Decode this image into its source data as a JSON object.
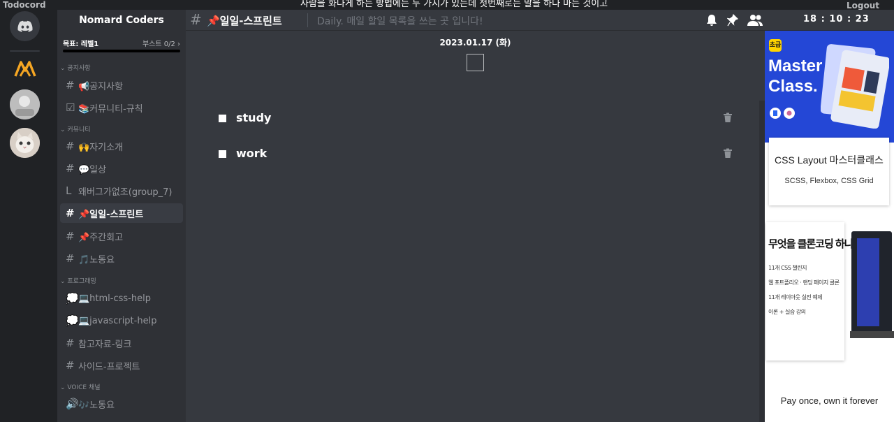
{
  "window": {
    "app_title": "Todocord",
    "quote": "사람을 화나게 하는 방법에는 두 가지가 있는데 첫번째로는 말을 하다 마는 것이고",
    "logout_label": "Logout"
  },
  "servers": [
    {
      "name": "discord-home",
      "icon": "discord-icon"
    },
    {
      "name": "nomad",
      "icon": "nomad-logo"
    },
    {
      "name": "avatar-1",
      "icon": "avatar"
    },
    {
      "name": "avatar-2",
      "icon": "cat-avatar"
    }
  ],
  "sidebar": {
    "server_name": "Nomard Coders",
    "goal_label": "목표: 레벨1",
    "boost_label": "부스트 0/2",
    "categories": {
      "notice": "⌄ 공지사항",
      "community": "⌄ 커뮤니티",
      "programming": "⌄ 프로그래밍",
      "voice": "⌄ VOICE 채널"
    },
    "channels": {
      "notice": "📢공지사항",
      "rules": "📚커뮤니티-규칙",
      "intro": "🙌자기소개",
      "daily": "💬일상",
      "thread": "왜버그가없조(group_7)",
      "sprint": "📌일일-스프린트",
      "weekly": "📌주간회고",
      "music": "🎵노동요",
      "html_css": "💻html-css-help",
      "javascript": "💻javascript-help",
      "reference": "참고자료-링크",
      "side_project": "사이드-프로젝트",
      "voice_music": "🎶노동요"
    }
  },
  "header": {
    "title": "📌일일-스프린트",
    "topic": "Daily. 매일 할일 목록을 쓰는 곳 입니다!",
    "clock": "18 : 10 : 23",
    "icons": [
      "bell-icon",
      "pin-icon",
      "members-icon"
    ]
  },
  "main": {
    "date": "2023.01.17 (화)",
    "todos": [
      {
        "text": "study",
        "done": false
      },
      {
        "text": "work",
        "done": false
      }
    ]
  },
  "ad": {
    "badge": "초급",
    "headline": "Master Class.",
    "card_title": "CSS Layout 마스터클래스",
    "card_sub": "SCSS, Flexbox, CSS Grid",
    "question": "무엇을 클론코딩 하나요?",
    "lines": [
      "11개 CSS 챌린지",
      "웹 포트폴리오 · 랜딩 페이지 클론",
      "11개 레이아웃 실전 예제",
      "이론 + 실습 강의"
    ],
    "footer": "Pay once, own it forever"
  },
  "colors": {
    "background": "#202225",
    "sidebar": "#2f3136",
    "main": "#36393f",
    "active_channel": "#393c43",
    "ad_blue": "#2447d6",
    "accent_yellow": "#ffd400"
  }
}
